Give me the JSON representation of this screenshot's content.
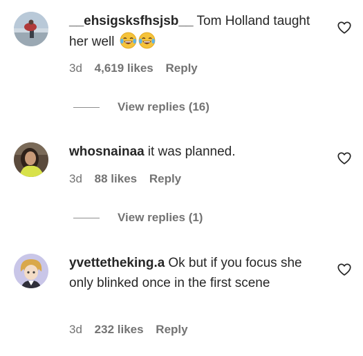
{
  "comments": [
    {
      "username": "__ehsigsksfhsjsb__",
      "text": "Tom Holland taught her well",
      "emojis": [
        "face-with-tears-of-joy",
        "face-with-tears-of-joy"
      ],
      "time": "3d",
      "likes": "4,619 likes",
      "reply_label": "Reply",
      "view_replies": "View replies (16)"
    },
    {
      "username": "whosnainaa",
      "text": "it was planned.",
      "time": "3d",
      "likes": "88 likes",
      "reply_label": "Reply",
      "view_replies": "View replies (1)"
    },
    {
      "username": "yvettetheking.a",
      "text": "Ok but if you focus she only blinked once in the first scene",
      "time": "3d",
      "likes": "232 likes",
      "reply_label": "Reply"
    }
  ],
  "icons": {
    "like": "heart-outline-icon"
  },
  "colors": {
    "text": "#262626",
    "secondary": "#737373"
  }
}
